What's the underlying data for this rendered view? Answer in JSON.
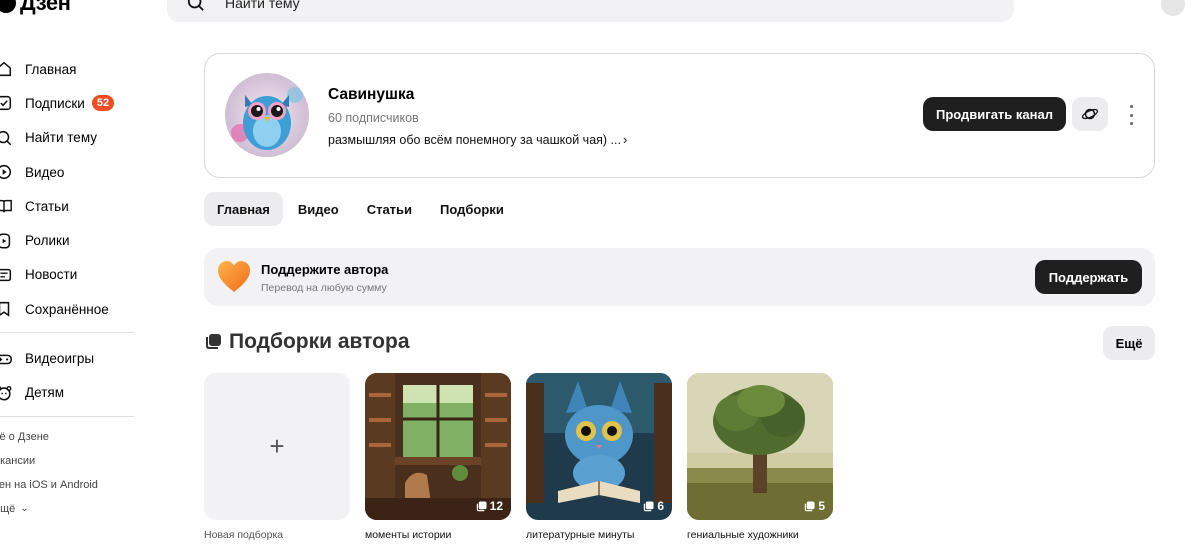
{
  "header": {
    "logo_text": "Дзен",
    "search_placeholder": "Найти тему"
  },
  "sidebar": {
    "items": [
      {
        "label": "Главная",
        "icon": "home-icon"
      },
      {
        "label": "Подписки",
        "icon": "subscriptions-icon",
        "badge": "52"
      },
      {
        "label": "Найти тему",
        "icon": "search-icon"
      },
      {
        "label": "Видео",
        "icon": "video-icon"
      },
      {
        "label": "Статьи",
        "icon": "articles-icon"
      },
      {
        "label": "Ролики",
        "icon": "clips-icon"
      },
      {
        "label": "Новости",
        "icon": "news-icon"
      },
      {
        "label": "Сохранённое",
        "icon": "bookmark-icon"
      }
    ],
    "items2": [
      {
        "label": "Видеоигры",
        "icon": "gamepad-icon"
      },
      {
        "label": "Детям",
        "icon": "kids-icon"
      }
    ],
    "footer": [
      "сё о Дзене",
      "акансии",
      "зен на iOS и Android",
      "ещё"
    ]
  },
  "channel": {
    "name": "Савинушка",
    "subscribers": "60 подписчиков",
    "description": "размышляя обо всём понемногу за чашкой чая) ...",
    "promote_label": "Продвигать канал"
  },
  "tabs": [
    "Главная",
    "Видео",
    "Статьи",
    "Подборки"
  ],
  "support": {
    "title": "Поддержите автора",
    "subtitle": "Перевод на любую сумму",
    "button": "Поддержать"
  },
  "collections": {
    "title": "Подборки автора",
    "more": "Ещё",
    "new_label": "Новая подборка",
    "items": [
      {
        "caption": "моменты истории",
        "count": "12"
      },
      {
        "caption": "литературные минуты",
        "count": "6"
      },
      {
        "caption": "гениальные художники",
        "count": "5"
      }
    ]
  },
  "colors": {
    "accent_badge": "#f04b22",
    "dark_button": "#1f1f1f",
    "light_surface": "#f2f2f4"
  }
}
